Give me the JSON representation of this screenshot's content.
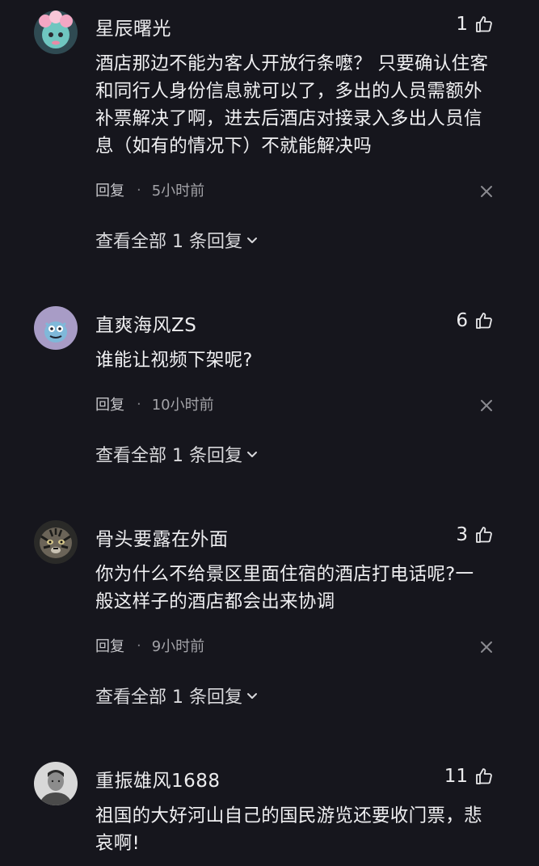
{
  "comments": [
    {
      "username": "星辰曙光",
      "likes": "1",
      "text": "酒店那边不能为客人开放行条嚒？ 只要确认住客和同行人身份信息就可以了，多出的人员需额外补票解决了啊，进去后酒店对接录入多出人员信息（如有的情况下）不就能解决吗",
      "reply_label": "回复",
      "dot": "·",
      "time": "5小时前",
      "expand_label": "查看全部 1 条回复"
    },
    {
      "username": "直爽海风ZS",
      "likes": "6",
      "text": "谁能让视频下架呢?",
      "reply_label": "回复",
      "dot": "·",
      "time": "10小时前",
      "expand_label": "查看全部 1 条回复"
    },
    {
      "username": "骨头要露在外面",
      "likes": "3",
      "text": "你为什么不给景区里面住宿的酒店打电话呢?一般这样子的酒店都会出来协调",
      "reply_label": "回复",
      "dot": "·",
      "time": "9小时前",
      "expand_label": "查看全部 1 条回复"
    },
    {
      "username": "重振雄风1688",
      "likes": "11",
      "text": "祖国的大好河山自己的国民游览还要收门票，悲哀啊!",
      "reply_label": "",
      "dot": "",
      "time": "",
      "expand_label": ""
    }
  ],
  "icons": {
    "like": "thumbs-up-icon",
    "close": "close-icon",
    "expand": "chevron-down-icon"
  },
  "colors": {
    "background": "#16161d",
    "text": "#f0f0f2",
    "muted": "#a3a3a8"
  }
}
